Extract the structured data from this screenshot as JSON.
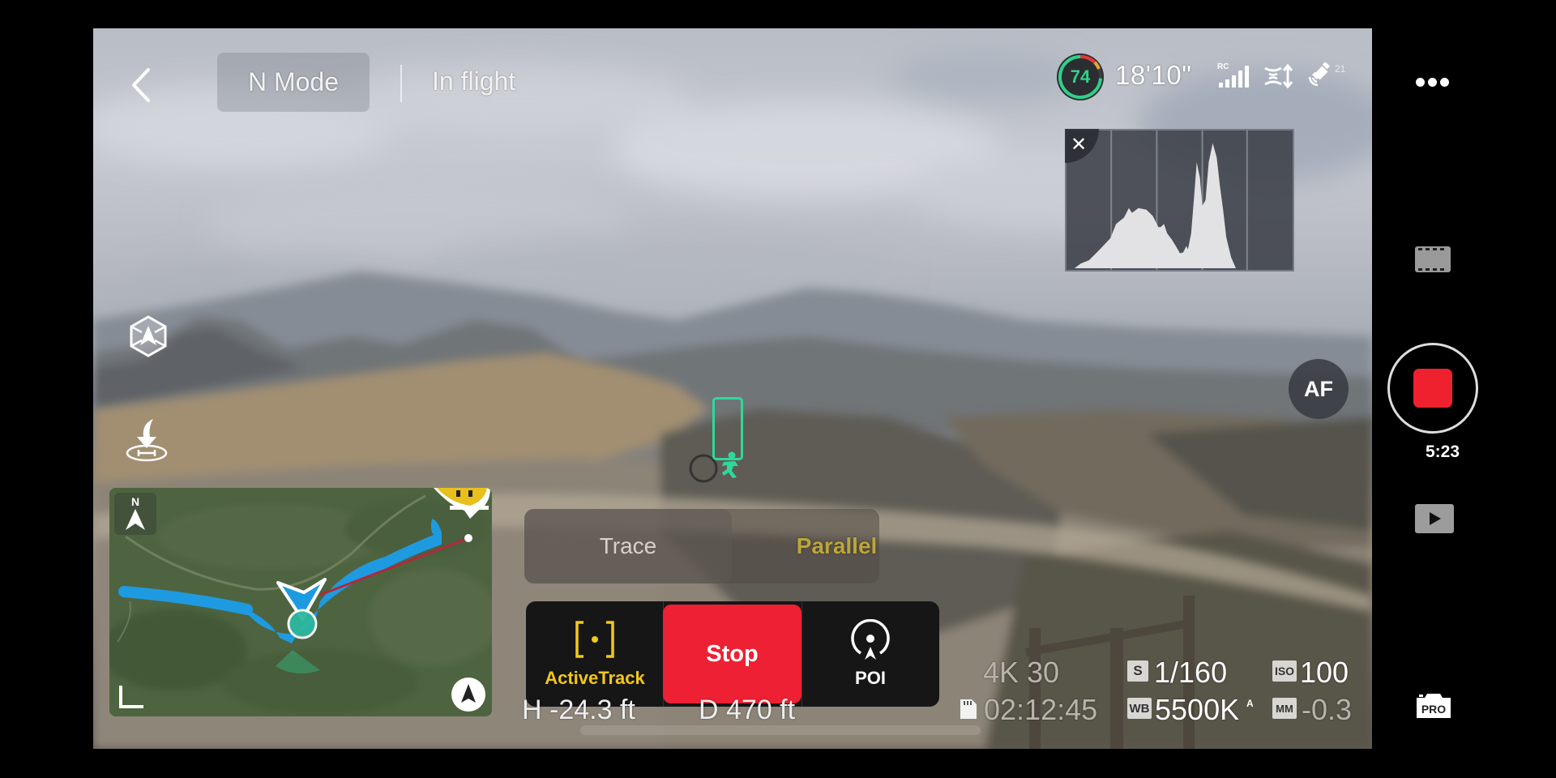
{
  "topbar": {
    "back_icon": "chevron-left-icon",
    "mode": "N Mode",
    "flight_status": "In flight",
    "battery_percent": "74",
    "battery_level": 0.74,
    "flight_time_remaining": "18'10\"",
    "rc_label": "RC",
    "rc_signal_bars": 5,
    "gps_satellites": "21"
  },
  "histogram": {
    "close_icon": "close-icon",
    "close_glyph": "✕"
  },
  "left_controls": {
    "obstacle_icon": "obstacle-avoidance-icon",
    "rth_icon": "return-to-home-icon"
  },
  "tracking": {
    "subject": "cyclist",
    "box_color": "#2fd89a"
  },
  "map": {
    "north_label": "N",
    "track_color": "#1e9be0",
    "line_color": "#b02a3a"
  },
  "focus": {
    "af_label": "AF"
  },
  "mode_switch": {
    "options": [
      "Trace",
      "Parallel"
    ],
    "selected": "Parallel",
    "trace_label": "Trace",
    "parallel_label": "Parallel"
  },
  "action_bar": {
    "activetrack_label": "ActiveTrack",
    "stop_label": "Stop",
    "poi_label": "POI"
  },
  "telemetry": {
    "height": "H -24.3 ft",
    "distance": "D 470 ft"
  },
  "camera": {
    "resolution_fps": "4K 30",
    "shutter_badge": "S",
    "shutter": "1/160",
    "iso_badge": "ISO",
    "iso": "100",
    "storage_remaining": "02:12:45",
    "wb_badge": "WB",
    "white_balance": "5500K",
    "wb_auto": "A",
    "ev_badge": "MM",
    "exposure_comp": "-0.3"
  },
  "right_panel": {
    "more_icon": "more-icon",
    "video_mode_icon": "film-icon",
    "record_time": "5:23",
    "playback_icon": "play-icon",
    "pro_label": "PRO"
  },
  "colors": {
    "stop_red": "#ee2033",
    "record_red": "#f0212e",
    "activetrack_yellow": "#f2c81a",
    "parallel_gold": "#bda63a",
    "battery_green": "#2fd18a"
  }
}
